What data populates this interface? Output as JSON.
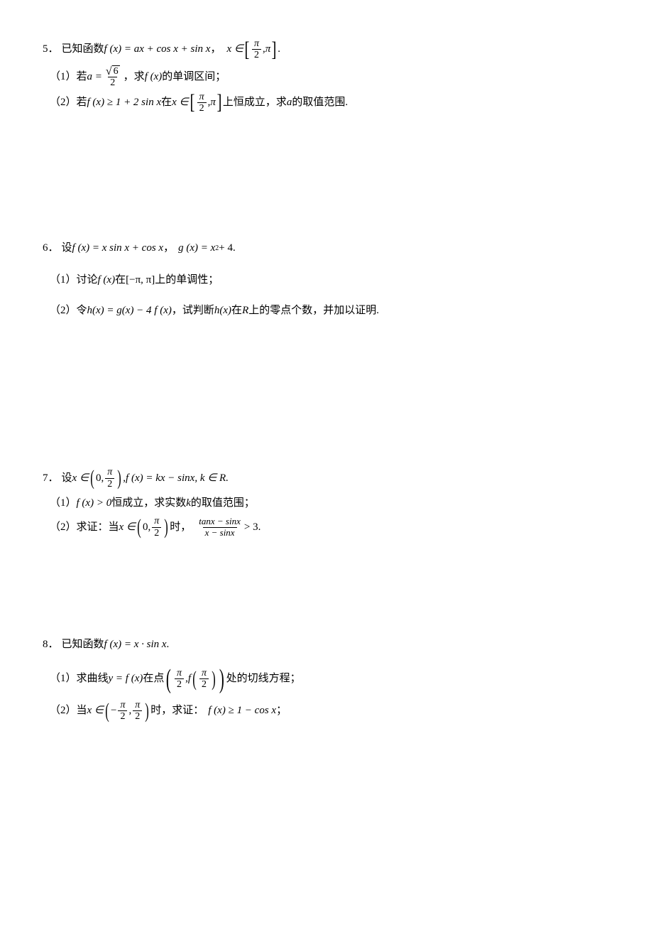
{
  "p5": {
    "num": "5．",
    "stem_a": "已知函数 ",
    "stem_fx": "f (x) = ax + cos x + sin x",
    "stem_comma": " ，",
    "stem_x": "x ∈",
    "stem_dot": " .",
    "pi": "π",
    "two": "2",
    "s1_num": "（1）若 ",
    "s1_a_eq": "a =",
    "sqrt6": "6",
    "s1_tail": " ，求 ",
    "s1_fx": "f (x)",
    "s1_tail2": " 的单调区间；",
    "s2_num": "（2）若 ",
    "s2_fx": "f (x) ≥ 1 + 2 sin x",
    "s2_mid": " 在 ",
    "s2_x": "x ∈",
    "s2_tail": " 上恒成立，求 ",
    "s2_a": "a",
    "s2_tail2": " 的取值范围."
  },
  "p6": {
    "num": "6．",
    "stem_a": "设 ",
    "fx": "f (x) = x sin x + cos x",
    "comma": "，",
    "gx": "g (x) = x",
    "sq": "2",
    "plus4": " + 4",
    "dot": " .",
    "s1_num": "（1）讨论 ",
    "s1_fx": "f (x)",
    "s1_mid": " 在 ",
    "s1_interval_l": "[−π, π]",
    "s1_tail": " 上的单调性；",
    "s2_num": "（2）令 ",
    "s2_hx": "h(x) = g(x) − 4 f (x)",
    "s2_mid": "，试判断 ",
    "s2_hx2": "h(x)",
    "s2_on": " 在 ",
    "s2_R": "R",
    "s2_tail": " 上的零点个数，并加以证明."
  },
  "p7": {
    "num": "7．",
    "stem_a": "设 ",
    "x_in": "x ∈",
    "comma": ", ",
    "fx": "f (x) = kx − sinx, k ∈ R.",
    "zero": "0",
    "pi": "π",
    "two": "2",
    "s1_num": "（1）",
    "s1_fx": "f (x) > 0",
    "s1_mid": " 恒成立，求实数 ",
    "s1_k": "k",
    "s1_tail": " 的取值范围；",
    "s2_num": "（2）求证：当 ",
    "s2_x": "x ∈",
    "s2_mid": " 时，",
    "frac_top": "tanx − sinx",
    "frac_bot": "x − sinx",
    "gt3": " > 3",
    "dot": " ."
  },
  "p8": {
    "num": "8．",
    "stem_a": "已知函数 ",
    "fx": "f (x) = x · sin x",
    "dot": " .",
    "s1_num": "（1）求曲线 ",
    "s1_y": "y = f (x)",
    "s1_mid": " 在点 ",
    "pi": "π",
    "two": "2",
    "comma": ", ",
    "f": "f",
    "s1_tail": " 处的切线方程；",
    "s2_num": "（2）当 ",
    "s2_x": "x ∈",
    "neg": "−",
    "s2_mid": " 时，求证：",
    "s2_fx": "f (x) ≥ 1 − cos x",
    "s2_tail": " ；"
  }
}
